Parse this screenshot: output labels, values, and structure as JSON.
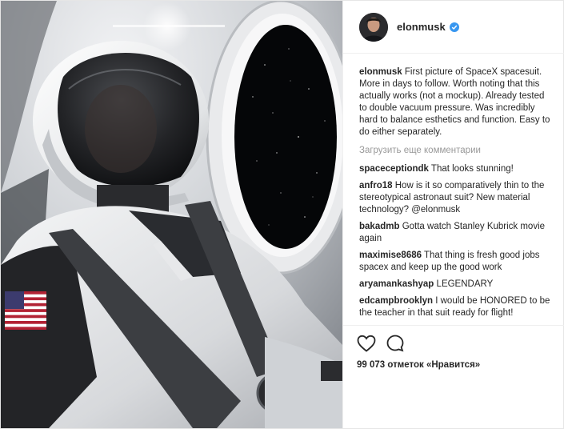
{
  "post": {
    "username": "elonmusk",
    "verified": true,
    "caption": "First picture of SpaceX spacesuit. More in days to follow. Worth noting that this actually works (not a mockup). Already tested to double vacuum pressure. Was incredibly hard to balance esthetics and function. Easy to do either separately.",
    "load_more": "Загрузить еще комментарии",
    "comments": [
      {
        "user": "spaceceptiondk",
        "text": "That looks stunning!"
      },
      {
        "user": "anfro18",
        "text": "How is it so comparatively thin to the stereotypical astronaut suit? New material technology? @elonmusk"
      },
      {
        "user": "bakadmb",
        "text": "Gotta watch Stanley Kubrick movie again"
      },
      {
        "user": "maximise8686",
        "text": "That thing is fresh good jobs spacex and keep up the good work"
      },
      {
        "user": "aryamankashyap",
        "text": "LEGENDARY"
      },
      {
        "user": "edcampbrooklyn",
        "text": "I would be HONORED to be the teacher in that suit ready for flight!"
      }
    ],
    "likes": "99 073 отметок «Нравится»"
  },
  "icons": {
    "like": "heart-icon",
    "comment": "comment-icon",
    "verified": "verified-badge-icon"
  },
  "colors": {
    "accent": "#3897f0",
    "text": "#262626",
    "muted": "#999999",
    "divider": "#efefef"
  }
}
